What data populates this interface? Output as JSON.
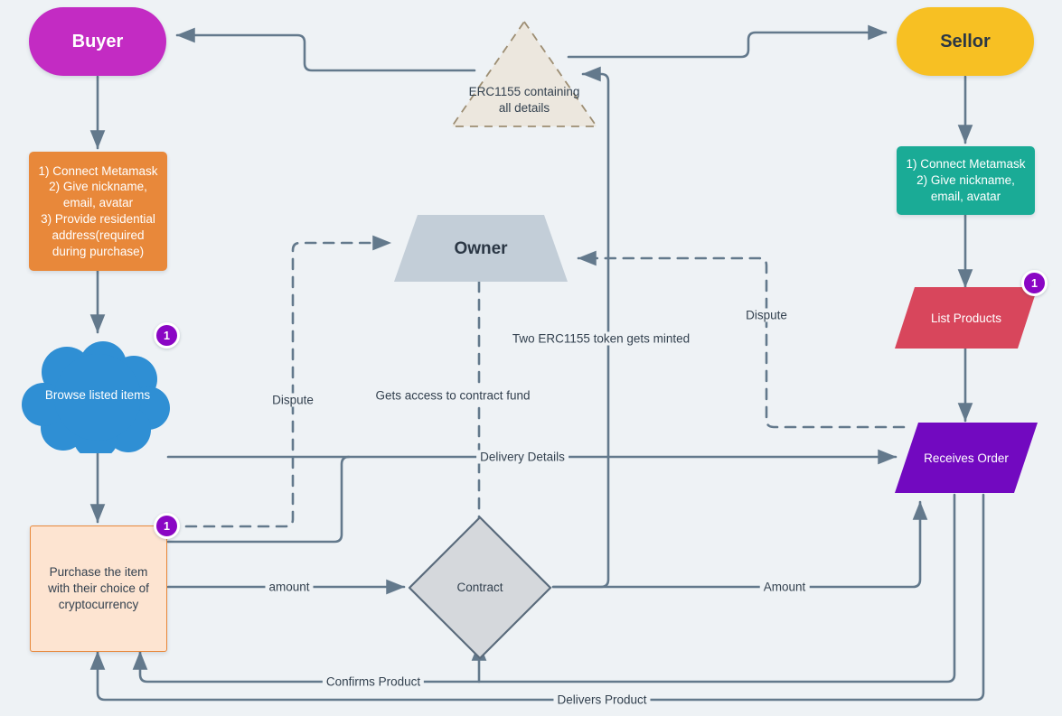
{
  "diagram": {
    "title": "Blockchain Marketplace Escrow Flowchart",
    "background": "#eef2f5",
    "edge_color": "#63798c",
    "badge_color": "#8a06c4"
  },
  "nodes": {
    "buyer": {
      "label": "Buyer",
      "fill": "#c32bc3",
      "text": "#ffffff",
      "shape": "stadium"
    },
    "sellor": {
      "label": "Sellor",
      "fill": "#f7c023",
      "text": "#2b3745",
      "shape": "stadium"
    },
    "buyer_steps": {
      "label": "1) Connect Metamask\n2) Give nickname,\nemail, avatar\n3) Provide residential\naddress(required\nduring purchase)",
      "fill": "#e8883a",
      "text": "#ffffff",
      "shape": "rect"
    },
    "seller_steps": {
      "label": "1) Connect Metamask\n2) Give nickname,\nemail, avatar",
      "fill": "#1aab96",
      "text": "#ffffff",
      "shape": "rect"
    },
    "erc1155": {
      "label": "ERC1155 containing\nall details",
      "fill": "#ece7de",
      "stroke": "#9d8e73",
      "text": "#33414f",
      "shape": "triangle-dashed"
    },
    "owner": {
      "label": "Owner",
      "fill": "#c3ced8",
      "text": "#2b3745",
      "shape": "trapezoid"
    },
    "browse": {
      "label": "Browse listed items",
      "fill": "#2f8fd4",
      "text": "#ffffff",
      "shape": "cloud"
    },
    "list_products": {
      "label": "List Products",
      "fill": "#d8465c",
      "text": "#ffffff",
      "shape": "parallelogram"
    },
    "receives_order": {
      "label": "Receives Order",
      "fill": "#7209c0",
      "text": "#ffffff",
      "shape": "parallelogram"
    },
    "purchase": {
      "label": "Purchase the item\nwith their choice of\ncryptocurrency",
      "fill": "#fde4d1",
      "stroke": "#e8883a",
      "text": "#33414f",
      "shape": "rect"
    },
    "contract": {
      "label": "Contract",
      "fill": "#d5d8dc",
      "stroke": "#5a6b7c",
      "text": "#33414f",
      "shape": "diamond"
    }
  },
  "badges": [
    {
      "id": "badge-browse",
      "value": "1"
    },
    {
      "id": "badge-purchase",
      "value": "1"
    },
    {
      "id": "badge-list-products",
      "value": "1"
    }
  ],
  "edge_labels": [
    {
      "id": "dispute-left",
      "text": "Dispute"
    },
    {
      "id": "dispute-right",
      "text": "Dispute"
    },
    {
      "id": "contract-fund",
      "text": "Gets access to contract fund"
    },
    {
      "id": "tokens-minted",
      "text": "Two ERC1155 token gets minted"
    },
    {
      "id": "delivery-details",
      "text": "Delivery Details"
    },
    {
      "id": "amount-lower",
      "text": "amount"
    },
    {
      "id": "amount-upper",
      "text": "Amount"
    },
    {
      "id": "confirms-product",
      "text": "Confirms Product"
    },
    {
      "id": "delivers-product",
      "text": "Delivers Product"
    }
  ]
}
